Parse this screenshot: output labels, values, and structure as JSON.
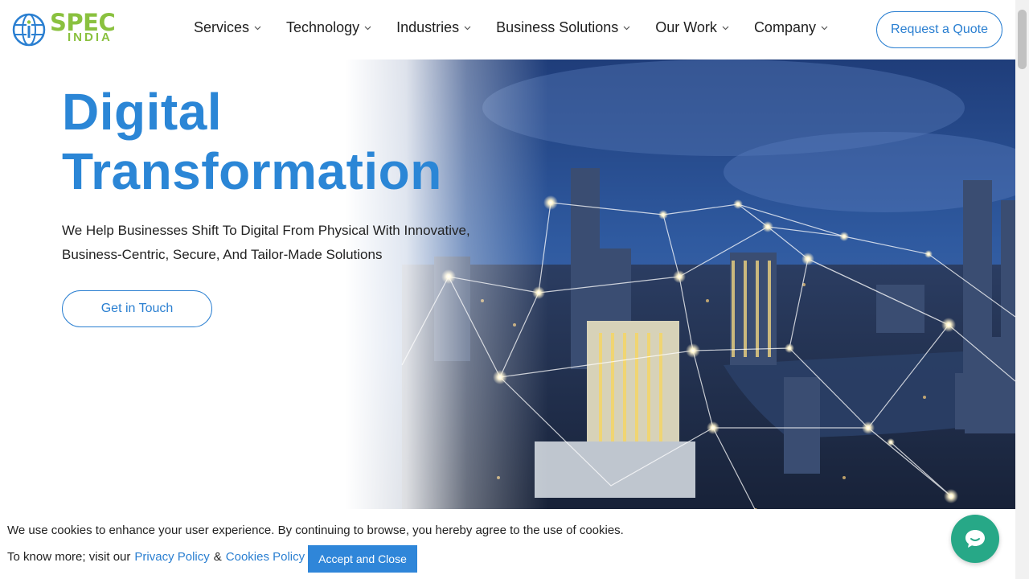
{
  "brand": {
    "name": "SPEC",
    "subname": "INDIA",
    "color": "#8ac13f",
    "icon": "globe-logo-icon"
  },
  "nav": {
    "items": [
      {
        "label": "Services"
      },
      {
        "label": "Technology"
      },
      {
        "label": "Industries"
      },
      {
        "label": "Business Solutions"
      },
      {
        "label": "Our Work"
      },
      {
        "label": "Company"
      }
    ],
    "chevron_icon": "chevron-down-icon",
    "quote_label": "Request a Quote"
  },
  "hero": {
    "title_line1": "Digital",
    "title_line2": "Transformation",
    "subtitle_line1": "We Help Businesses Shift To Digital From Physical With Innovative,",
    "subtitle_line2": "Business-Centric, Secure, And Tailor-Made Solutions",
    "cta_label": "Get in Touch",
    "title_color": "#2b86d6",
    "background": "night-city-network-image"
  },
  "cookie": {
    "text": "We use cookies to enhance your user experience. By continuing to browse, you hereby agree to the use of cookies.",
    "prefix": "To know more; visit our",
    "privacy_label": "Privacy Policy",
    "amp": "&",
    "cookies_label": "Cookies Policy",
    "accept_label": "Accept and Close"
  },
  "chat": {
    "icon": "chat-bubble-icon",
    "color": "#27a887"
  },
  "accent": "#2a7fd1"
}
